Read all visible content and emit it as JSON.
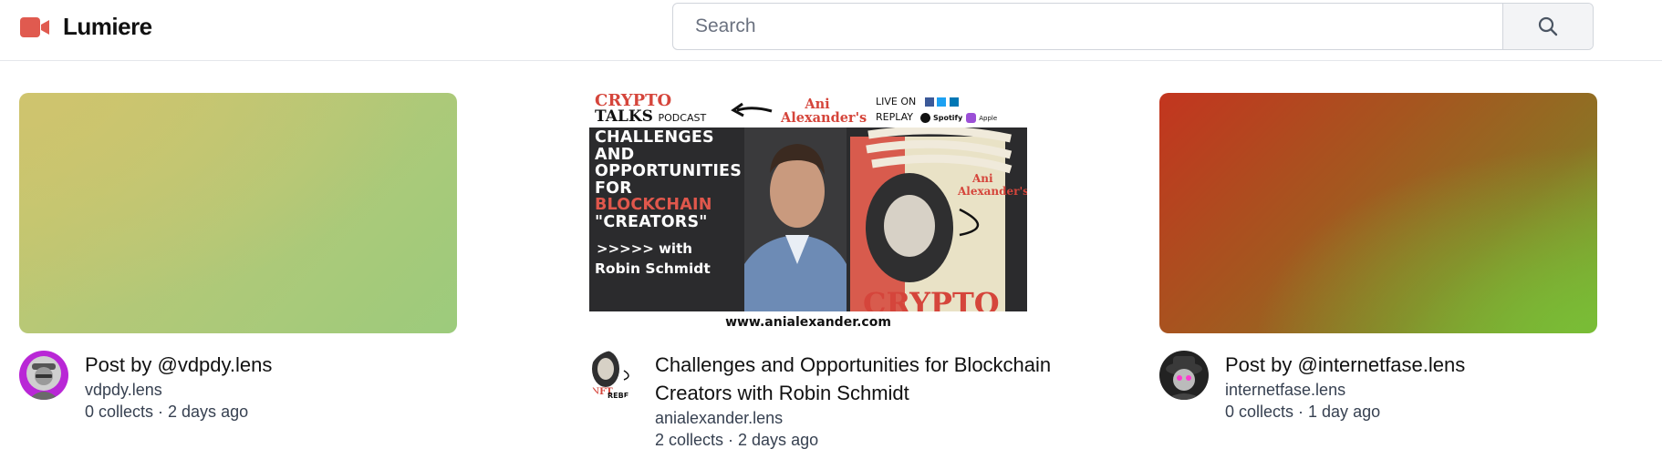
{
  "app": {
    "name": "Lumiere",
    "logo_icon": "video-camera-icon",
    "accent": "#e05a4f"
  },
  "search": {
    "placeholder": "Search",
    "value": "",
    "button_icon": "search-icon"
  },
  "posts": [
    {
      "title": "Post by @vdpdy.lens",
      "handle": "vdpdy.lens",
      "stats": "0 collects · 2 days ago",
      "thumbnail": "gradient"
    },
    {
      "title": "Challenges and Opportunities for Blockchain Creators with Robin Schmidt",
      "handle": "anialexander.lens",
      "stats": "2 collects · 2 days ago",
      "thumbnail": "crypto-talks",
      "thumbnail_text": {
        "brand1": "CRYPTO",
        "brand2": "TALKS",
        "podcast": "PODCAST",
        "ani": "Ani Alexander's",
        "live": "LIVE ON",
        "replay": "REPLAY",
        "headline_1": "CHALLENGES",
        "headline_2": "AND",
        "headline_3": "OPPORTUNITIES",
        "headline_4": "FOR",
        "headline_5": "BLOCKCHAIN",
        "headline_6": "\"CREATORS\"",
        "with": ">>>>> with",
        "guest": "Robin Schmidt",
        "crypto_big": "CRYPTO",
        "url": "www.anialexander.com"
      }
    },
    {
      "title": "Post by @internetfase.lens",
      "handle": "internetfase.lens",
      "stats": "0 collects · 1 day ago",
      "thumbnail": "gradient"
    }
  ]
}
